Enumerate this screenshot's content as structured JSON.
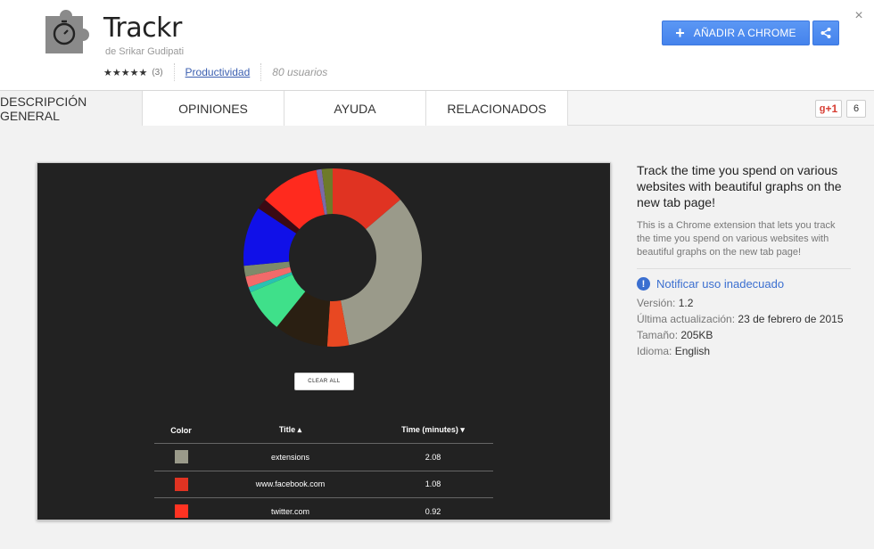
{
  "header": {
    "title": "Trackr",
    "author": "de Srikar Gudipati",
    "stars": "★★★★★",
    "rating_count": "(3)",
    "category": "Productividad",
    "users": "80 usuarios",
    "add_button": "AÑADIR A CHROME",
    "close": "×"
  },
  "tabs": [
    {
      "label": "DESCRIPCIÓN GENERAL"
    },
    {
      "label": "OPINIONES"
    },
    {
      "label": "AYUDA"
    },
    {
      "label": "RELACIONADOS"
    }
  ],
  "social": {
    "gplus_label": "+1",
    "gplus_count": "6"
  },
  "screenshot": {
    "clear_button": "CLEAR ALL",
    "table": {
      "headers": {
        "color": "Color",
        "title": "Title ▴",
        "time": "Time (minutes) ▾"
      },
      "rows": [
        {
          "color": "#9a9a8a",
          "title": "extensions",
          "time": "2.08"
        },
        {
          "color": "#e03322",
          "title": "www.facebook.com",
          "time": "1.08"
        },
        {
          "color": "#ff3322",
          "title": "twitter.com",
          "time": "0.92"
        }
      ]
    },
    "donut": [
      {
        "color": "#e03322",
        "value": 14
      },
      {
        "color": "#9a9a8a",
        "value": 34
      },
      {
        "color": "#e84822",
        "value": 4
      },
      {
        "color": "#2a1f12",
        "value": 10
      },
      {
        "color": "#3fe08a",
        "value": 8
      },
      {
        "color": "#29c1b1",
        "value": 1
      },
      {
        "color": "#f26a6a",
        "value": 2
      },
      {
        "color": "#7d8a6a",
        "value": 2
      },
      {
        "color": "#1010e8",
        "value": 11
      },
      {
        "color": "#3a0a14",
        "value": 2
      },
      {
        "color": "#ff2a1e",
        "value": 11
      },
      {
        "color": "#7a6aa8",
        "value": 1
      },
      {
        "color": "#6e7a2a",
        "value": 2
      }
    ]
  },
  "description": {
    "title": "Track the time you spend on various websites with beautiful graphs on the new tab page!",
    "body": "This is a Chrome extension that lets you track the time you spend on various websites with beautiful graphs on the new tab page!",
    "report": "Notificar uso inadecuado",
    "version_label": "Versión:",
    "version": "1.2",
    "updated_label": "Última actualización:",
    "updated": "23 de febrero de 2015",
    "size_label": "Tamaño:",
    "size": "205KB",
    "language_label": "Idioma:",
    "language": "English"
  },
  "colors": {
    "accent": "#4d90fe",
    "link": "#3b5fb0"
  }
}
